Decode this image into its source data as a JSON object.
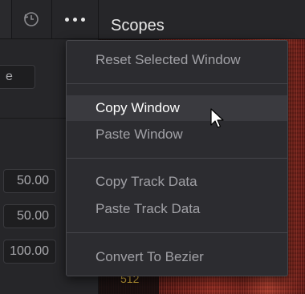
{
  "topbar": {
    "title": "Scopes",
    "sync_icon": "sync-icon",
    "more_icon": "more-dots-icon"
  },
  "left_panel": {
    "top_input_partial": "e",
    "fields": [
      "50.00",
      "50.00",
      "100.00"
    ]
  },
  "scope": {
    "axis_label": "512"
  },
  "menu": {
    "items": [
      {
        "label": "Reset Selected Window"
      },
      {
        "label": "Copy Window"
      },
      {
        "label": "Paste Window"
      },
      {
        "label": "Copy Track Data"
      },
      {
        "label": "Paste Track Data"
      },
      {
        "label": "Convert To Bezier"
      }
    ],
    "highlighted": "Copy Window"
  },
  "colors": {
    "menu_bg": "#2c2c30",
    "highlight_bg": "#3a3a3f",
    "text_dim": "#a1a1a6",
    "text_active": "#ffffff"
  }
}
